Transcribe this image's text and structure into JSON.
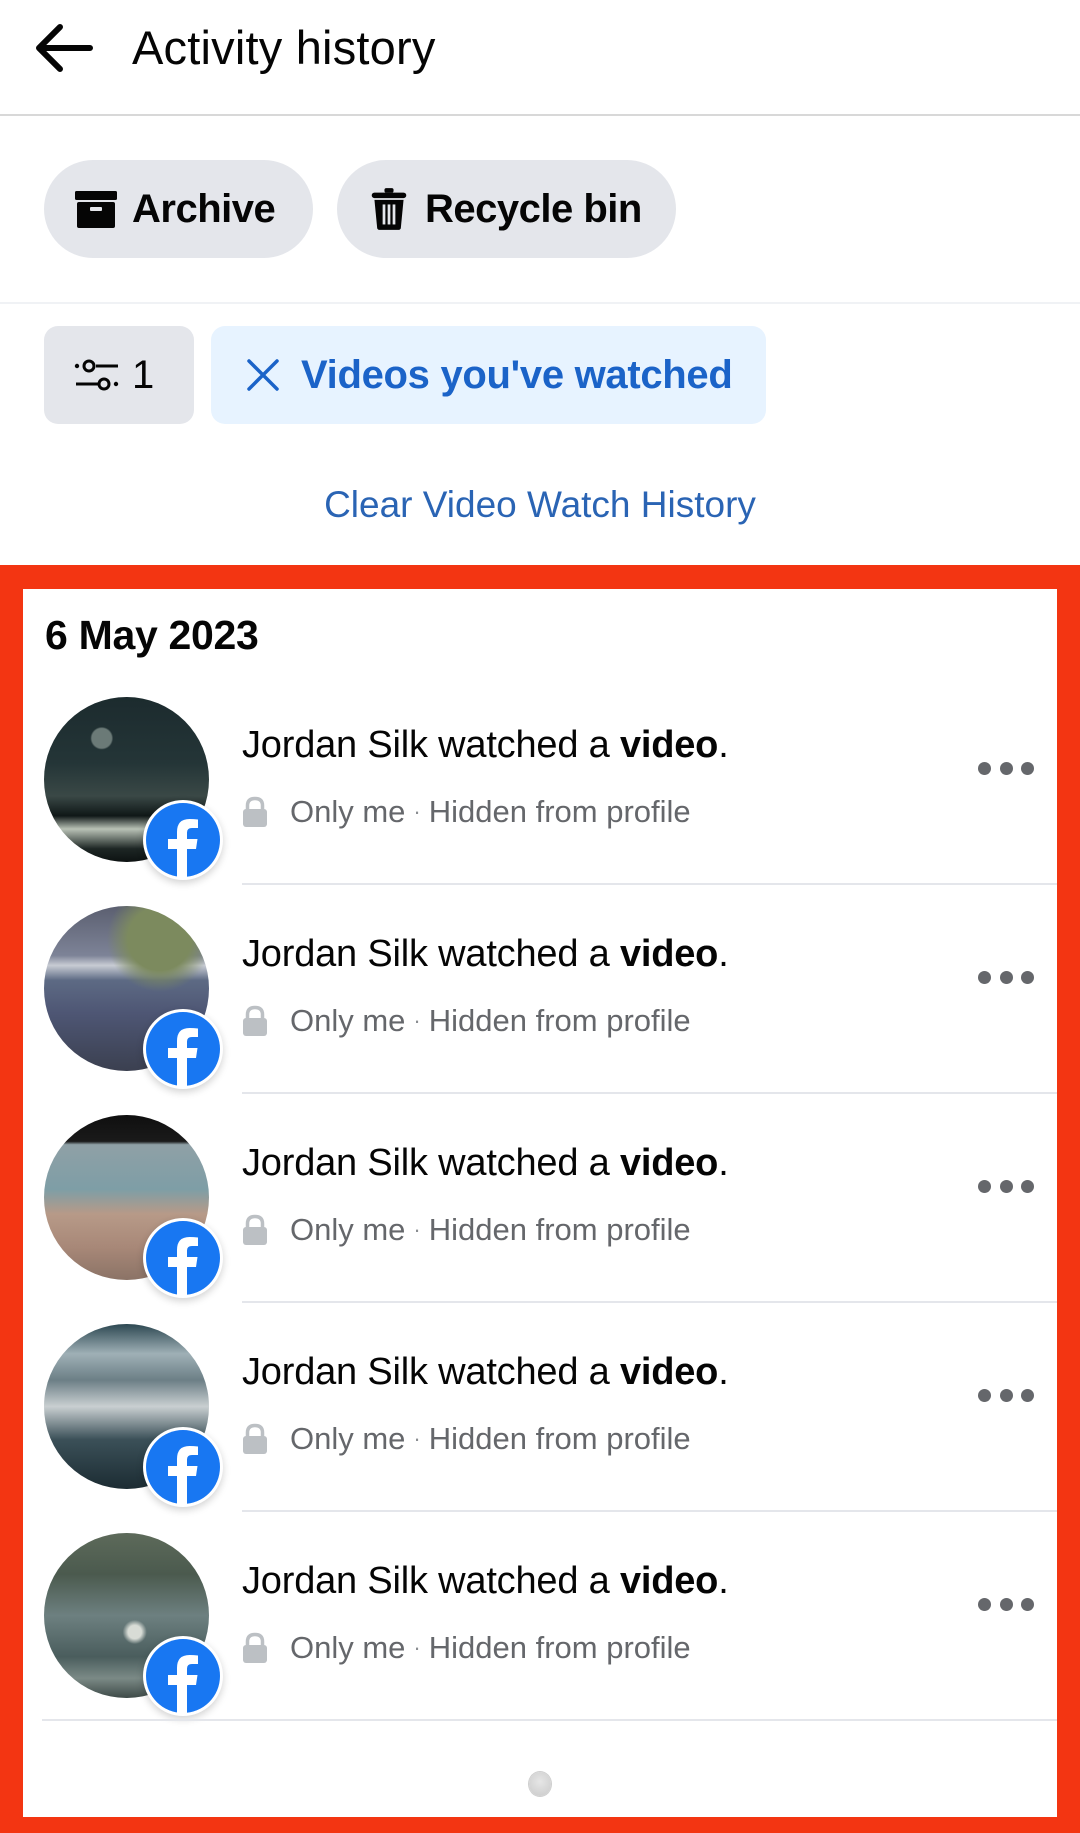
{
  "header": {
    "back_icon": "arrow-left-icon",
    "title": "Activity history"
  },
  "actions": {
    "archive": {
      "label": "Archive",
      "icon": "archive-box-icon"
    },
    "recycle_bin": {
      "label": "Recycle bin",
      "icon": "trash-icon"
    }
  },
  "filters": {
    "count_icon": "sliders-icon",
    "active_count": "1",
    "active_filter": {
      "label": "Videos you've watched",
      "icon": "close-icon"
    },
    "clear_link": "Clear Video Watch History"
  },
  "colors": {
    "accent_blue": "#1b63c8",
    "link_blue": "#2a64b4",
    "chip_bg": "#e4e6eb",
    "filter_chip_bg": "#e7f3ff",
    "highlight_red": "#f33512",
    "facebook_blue": "#1877f2"
  },
  "section": {
    "date": "6 May 2023",
    "items": [
      {
        "actor": "Jordan Silk",
        "action": " watched a ",
        "object": "video",
        "end": ".",
        "audience": "Only me",
        "separator": "·",
        "visibility": "Hidden from profile",
        "thumb": "dark-screen-thumbnail",
        "badge": "facebook-icon",
        "more": "more-options-icon"
      },
      {
        "actor": "Jordan Silk",
        "action": " watched a ",
        "object": "video",
        "end": ".",
        "audience": "Only me",
        "separator": "·",
        "visibility": "Hidden from profile",
        "thumb": "grey-outdoor-thumbnail",
        "badge": "facebook-icon",
        "more": "more-options-icon"
      },
      {
        "actor": "Jordan Silk",
        "action": " watched a ",
        "object": "video",
        "end": ".",
        "audience": "Only me",
        "separator": "·",
        "visibility": "Hidden from profile",
        "thumb": "person-water-thumbnail",
        "badge": "facebook-icon",
        "more": "more-options-icon"
      },
      {
        "actor": "Jordan Silk",
        "action": " watched a ",
        "object": "video",
        "end": ".",
        "audience": "Only me",
        "separator": "·",
        "visibility": "Hidden from profile",
        "thumb": "river-thumbnail",
        "badge": "facebook-icon",
        "more": "more-options-icon"
      },
      {
        "actor": "Jordan Silk",
        "action": " watched a ",
        "object": "video",
        "end": ".",
        "audience": "Only me",
        "separator": "·",
        "visibility": "Hidden from profile",
        "thumb": "forest-thumbnail",
        "badge": "facebook-icon",
        "more": "more-options-icon"
      }
    ]
  },
  "loading_indicator": "spinner-icon"
}
